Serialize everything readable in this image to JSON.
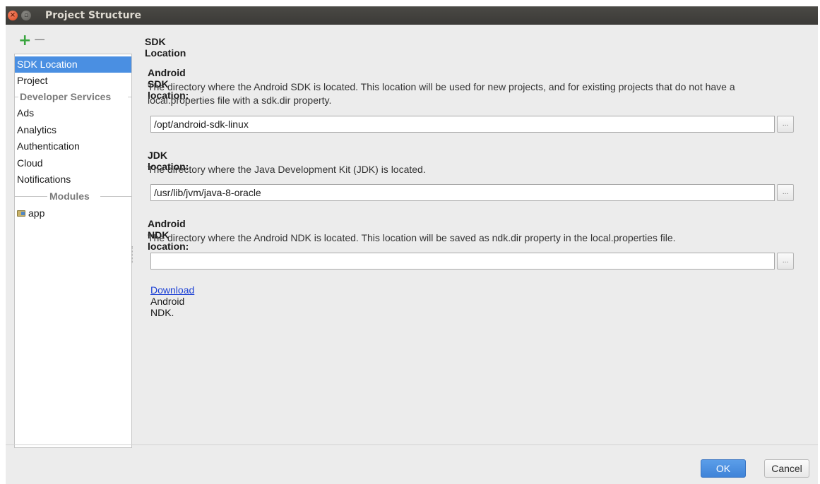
{
  "window": {
    "title": "Project Structure",
    "close_glyph": "×",
    "minimize_glyph": "▫"
  },
  "toolbar": {
    "add_icon": "plus-icon",
    "add_glyph": "+",
    "remove_icon": "minus-icon",
    "remove_glyph": "−"
  },
  "sidebar": {
    "items": [
      {
        "label": "SDK Location",
        "selected": true
      },
      {
        "label": "Project"
      }
    ],
    "developer_services_header": "Developer Services",
    "service_items": [
      "Ads",
      "Analytics",
      "Authentication",
      "Cloud",
      "Notifications"
    ],
    "modules_header": "Modules",
    "module_items": [
      {
        "label": "app",
        "icon": "module-folder-icon"
      }
    ]
  },
  "main": {
    "page_title": "SDK Location",
    "android_sdk": {
      "heading": "Android SDK location:",
      "description": "The directory where the Android SDK is located. This location will be used for new projects, and for existing projects that do not have a local.properties file with a sdk.dir property.",
      "value": "/opt/android-sdk-linux",
      "browse_label": "..."
    },
    "jdk": {
      "heading": "JDK location:",
      "description": "The directory where the Java Development Kit (JDK) is located.",
      "value": "/usr/lib/jvm/java-8-oracle",
      "browse_label": "..."
    },
    "android_ndk": {
      "heading": "Android NDK location:",
      "description": "The directory where the Android NDK is located. This location will be saved as ndk.dir property in the local.properties file.",
      "value": "",
      "browse_label": "...",
      "download_link": "Download",
      "download_suffix": " Android NDK."
    }
  },
  "footer": {
    "ok_label": "OK",
    "cancel_label": "Cancel"
  },
  "colors": {
    "selection": "#4a8fe2",
    "ok_button": "#4a8fe2",
    "link": "#1a3fd4",
    "add_icon": "#3aa53f"
  }
}
